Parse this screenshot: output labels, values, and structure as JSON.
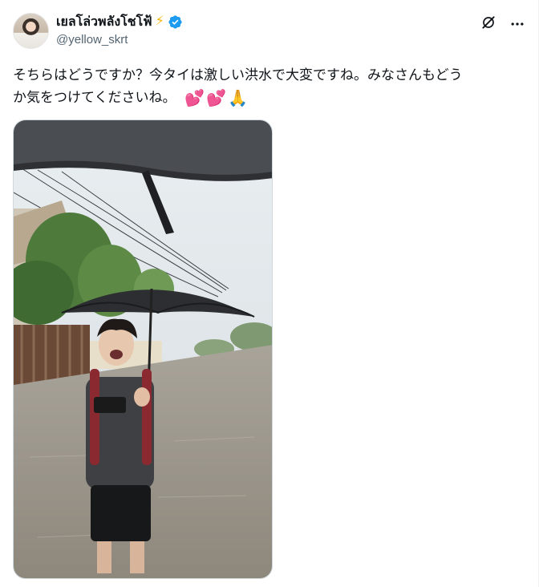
{
  "author": {
    "display_name": "เยลโล่วพลังโชโฟ้",
    "name_emoji": "⚡",
    "handle": "@yellow_skrt",
    "verified": true,
    "verified_color": "#1d9bf0"
  },
  "actions": {
    "grok_icon": "grok-icon",
    "more_icon": "more-icon"
  },
  "post": {
    "text_line1": "そちらはどうですか？今タイは激しい洪水で大変ですね。みなさんもどう",
    "text_line2": "か気をつけてくださいね。",
    "emojis": [
      "💕",
      "💕",
      "🙏"
    ]
  },
  "media": {
    "type": "video-thumbnail",
    "icon": "photo"
  }
}
